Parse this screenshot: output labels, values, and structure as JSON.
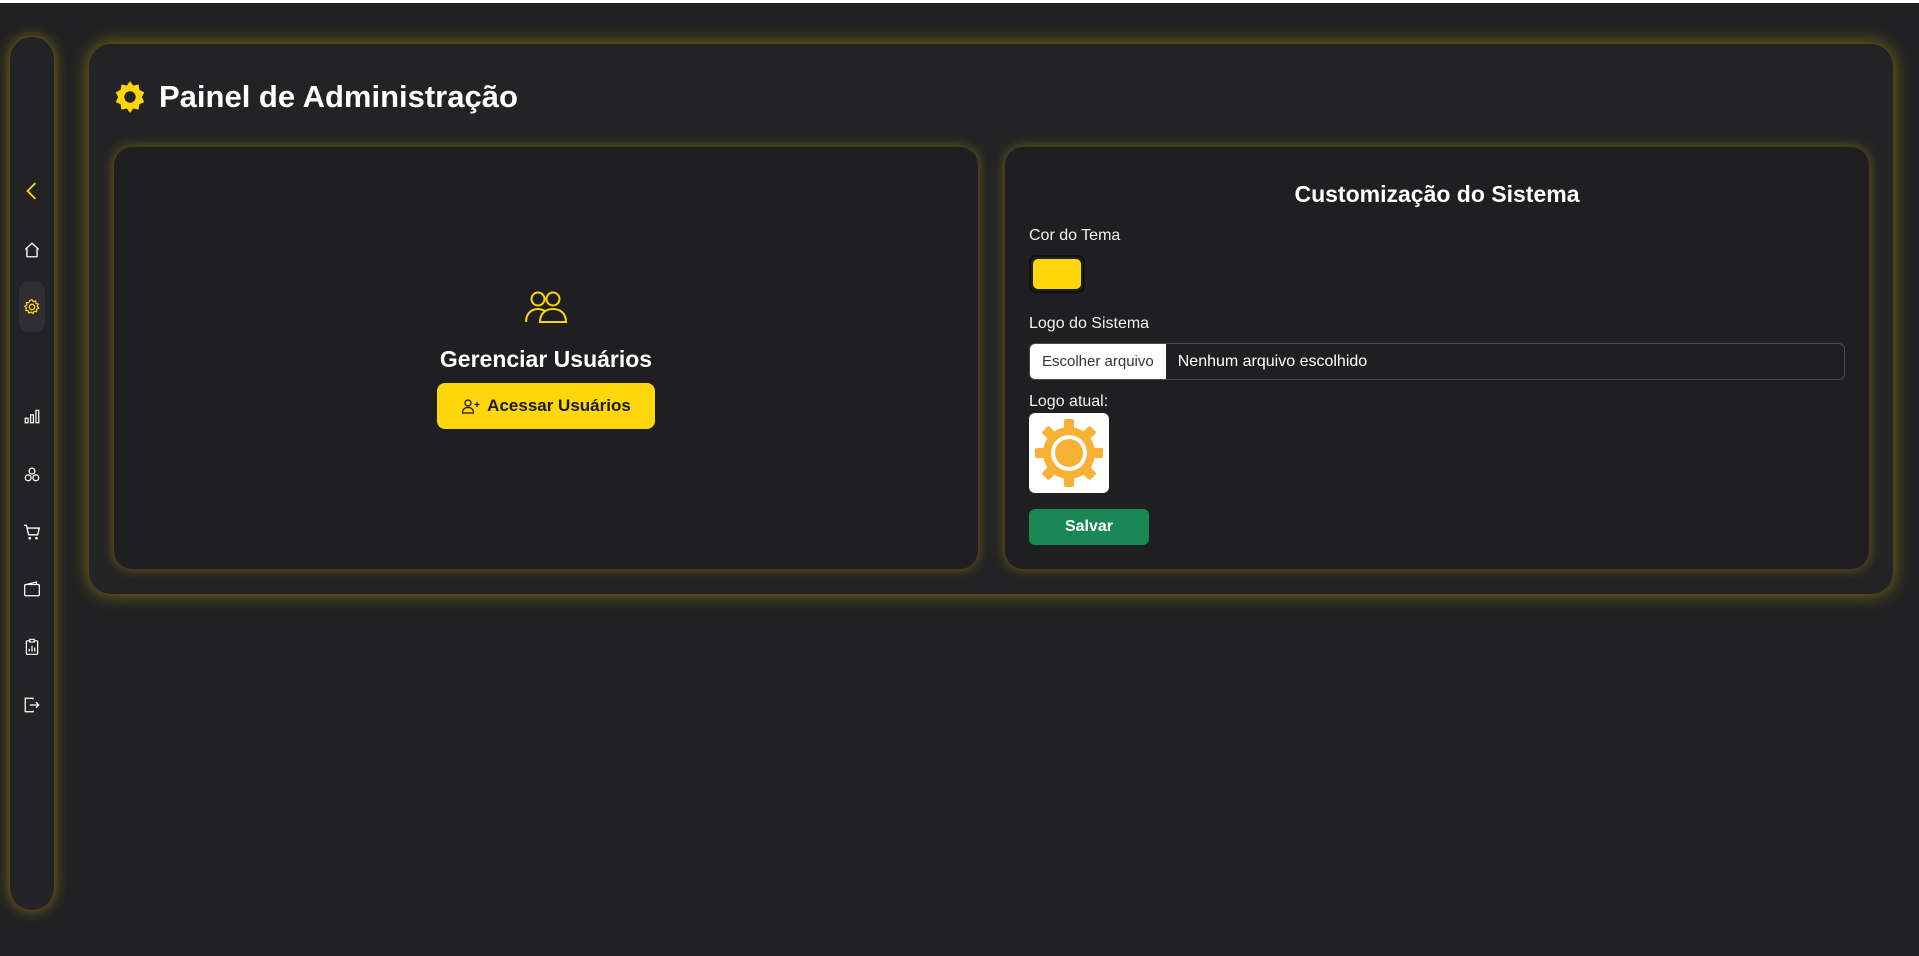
{
  "colors": {
    "accent": "#FFD60A",
    "background": "#212123",
    "panel": "#232325",
    "card": "#1F1F21",
    "save_green": "#198754",
    "logo_orange": "#F8B133"
  },
  "sidebar": {
    "items": [
      {
        "icon": "chevron-left-icon"
      },
      {
        "icon": "home-icon"
      },
      {
        "icon": "gear-icon",
        "active": true
      },
      {
        "icon": "bar-chart-icon"
      },
      {
        "icon": "boxes-icon"
      },
      {
        "icon": "cart-icon"
      },
      {
        "icon": "wallet-icon"
      },
      {
        "icon": "clipboard-chart-icon"
      },
      {
        "icon": "logout-icon"
      }
    ]
  },
  "header": {
    "icon": "gear-icon",
    "title": "Painel de Administração"
  },
  "users_card": {
    "icon": "users-icon",
    "title": "Gerenciar Usuários",
    "button_icon": "person-plus-icon",
    "button_label": "Acessar Usuários"
  },
  "customization": {
    "title": "Customização do Sistema",
    "theme_color_label": "Cor do Tema",
    "theme_color_value": "#FFD60A",
    "logo_label": "Logo do Sistema",
    "file_button_label": "Escolher arquivo",
    "file_status": "Nenhum arquivo escolhido",
    "current_logo_label": "Logo atual:",
    "current_logo_icon": "gear-logo-icon",
    "save_label": "Salvar"
  }
}
